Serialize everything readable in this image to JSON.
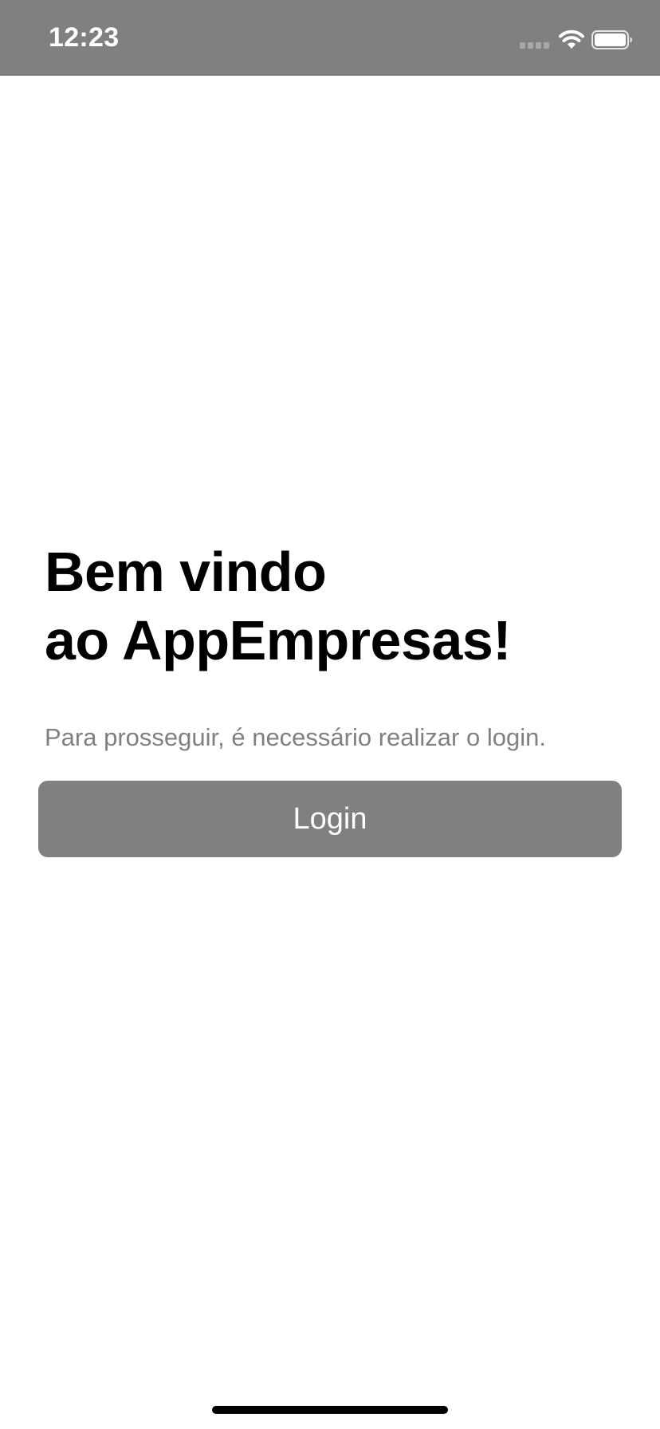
{
  "status_bar": {
    "time": "12:23",
    "icons": [
      "cellular-signal-icon",
      "wifi-icon",
      "battery-icon"
    ],
    "background_color": "#808080"
  },
  "welcome": {
    "title_line_1": "Bem vindo",
    "title_line_2": "ao AppEmpresas!",
    "subtitle": "Para prosseguir, é necessário realizar o login."
  },
  "login_button": {
    "label": "Login",
    "background_color": "#808080"
  }
}
